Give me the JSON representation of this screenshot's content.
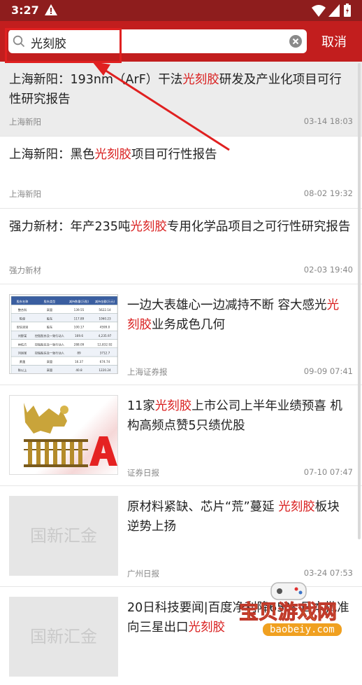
{
  "status": {
    "time": "3:27"
  },
  "search": {
    "query": "光刻胶",
    "cancel_label": "取消"
  },
  "results": [
    {
      "title_pre": "上海新阳：193nm（ArF）干法",
      "title_hl": "光刻胶",
      "title_post": "研发及产业化项目可行性研究报告",
      "source": "上海新阳",
      "time": "03-14 18:03"
    },
    {
      "title_pre": "上海新阳：黑色",
      "title_hl": "光刻胶",
      "title_post": "项目可行性报告",
      "source": "上海新阳",
      "time": "08-02 19:32"
    },
    {
      "title_pre": "强力新材：年产235吨",
      "title_hl": "光刻胶",
      "title_post": "专用化学品项目之可行性研究报告",
      "source": "强力新材",
      "time": "02-03 19:40"
    },
    {
      "title_pre": "一边大表雄心一边减持不断 容大感光",
      "title_hl": "光刻胶",
      "title_post": "业务成色几何",
      "source": "上海证券报",
      "time": "09-09 07:41"
    },
    {
      "title_pre": "11家",
      "title_hl": "光刻胶",
      "title_post": "上市公司上半年业绩预喜 机构高频点赞5只绩优股",
      "source": "证券日报",
      "time": "07-10 07:47"
    },
    {
      "title_pre": "原材料紧缺、芯片“荒”蔓延 ",
      "title_hl": "光刻胶",
      "title_post": "板块逆势上扬",
      "source": "广州日报",
      "time": "03-24 07:53"
    },
    {
      "title_pre": "20日科技要闻|百度净利降65% 日本批准向三星出口",
      "title_hl": "光刻胶",
      "title_post": "",
      "source": "",
      "time": ""
    }
  ],
  "placeholder_logo": "国新汇金",
  "watermark": {
    "text": "宝贝游戏网",
    "url": "baobeiy.com"
  },
  "table_thumb": {
    "headers": [
      "股东名称",
      "股东类型",
      "减持数量(万股)",
      "减持金额(万元)"
    ],
    "rows": [
      [
        "整合科",
        "高管",
        "139.55",
        "5622.14"
      ],
      [
        "陈俊",
        "股东",
        "117.89",
        "1060.23"
      ],
      [
        "安信贤贤",
        "股东",
        "100.17",
        "4599.0"
      ],
      [
        "刘野某",
        "控股股东及一致行动人",
        "169.6",
        "4,235.97"
      ],
      [
        "林佑方",
        "控股股东及一致行动人",
        "288.09",
        "12,832.92"
      ],
      [
        "刘旭某",
        "控股股东及一致行动人",
        "89",
        "3712.7"
      ],
      [
        "黄蓬",
        "高管",
        "16.37",
        "674.74"
      ],
      [
        "陈以上",
        "高管",
        "40.8",
        "1220.24"
      ]
    ]
  },
  "colors": {
    "status_bar": "#8e1d1d",
    "search_bar": "#c21e1e",
    "highlight": "#d91f1f"
  }
}
